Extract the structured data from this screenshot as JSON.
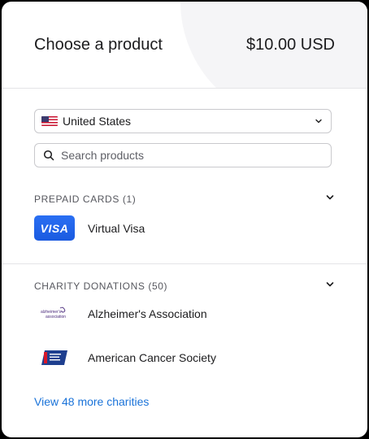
{
  "header": {
    "title": "Choose a product",
    "price": "$10.00 USD"
  },
  "country_select": {
    "value": "United States",
    "flag_icon": "us-flag-icon"
  },
  "search": {
    "placeholder": "Search products"
  },
  "prepaid": {
    "title": "PREPAID CARDS (1)",
    "items": [
      {
        "name": "Virtual Visa",
        "logo_text": "VISA"
      }
    ]
  },
  "charity": {
    "title": "CHARITY DONATIONS (50)",
    "items": [
      {
        "name": "Alzheimer's Association",
        "logo_text": "alzheimer's association"
      },
      {
        "name": "American Cancer Society",
        "logo_text": "American Cancer Society"
      }
    ],
    "more_link": "View 48 more charities"
  },
  "colors": {
    "link": "#1a73d9",
    "visa_blue": "#1a5ae0",
    "acs_red": "#d7182a",
    "acs_blue": "#1e3f8f",
    "alz_purple": "#4a2a7c"
  }
}
